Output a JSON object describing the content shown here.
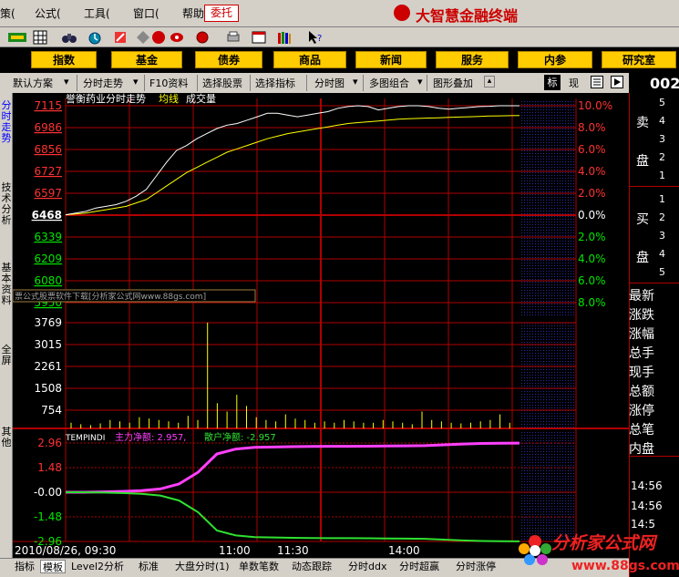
{
  "menubar": {
    "items": [
      "策(",
      "公式(",
      "工具(",
      "窗口(",
      "帮助("
    ],
    "weituo": "委托",
    "brand": "大智慧金融终端"
  },
  "nav": {
    "buttons": [
      "指数",
      "基金",
      "债券",
      "商品",
      "新闻",
      "服务",
      "内参",
      "研究室"
    ]
  },
  "ctrlbar": {
    "items": [
      "默认方案",
      "分时走势",
      "F10资料",
      "选择股票",
      "选择指标",
      "分时图",
      "多图组合",
      "图形叠加"
    ],
    "biao": "标",
    "xian": "现"
  },
  "leftstrip": {
    "tabs": [
      "分时走势",
      "技术分析",
      "基本资料",
      "全屏",
      "其他"
    ]
  },
  "chart": {
    "title": "誉衡药业分时走势",
    "avg_label": "均线",
    "vol_label": "成交量",
    "watermark": "票公式股票软件下载[分析家公式网www.88gs.com]",
    "indicator_name": "TEMPINDI",
    "main_label": "主力净额: 2.957,",
    "retail_label": "散户净额: -2.957",
    "date_label": "2010/08/26, 09:30",
    "time_ticks": [
      "11:00",
      "11:30",
      "14:00"
    ]
  },
  "chart_data": {
    "type": "line",
    "price_axis": {
      "ticks": [
        "7115",
        "6986",
        "6856",
        "6727",
        "6597",
        "6468",
        "6339",
        "6209",
        "6080",
        "5950"
      ],
      "pct_ticks": [
        "10.0%",
        "8.0%",
        "6.0%",
        "4.0%",
        "2.0%",
        "0.0%",
        "2.0%",
        "4.0%",
        "6.0%",
        "8.0%"
      ],
      "prev_close": 6468
    },
    "volume_axis": {
      "ticks": [
        "3769",
        "3015",
        "2261",
        "1508",
        "754"
      ]
    },
    "indicator_axis": {
      "ticks": [
        "2.96",
        "1.48",
        "-0.00",
        "-1.48",
        "-2.96"
      ]
    },
    "series": [
      {
        "name": "",
        "values": [
          6470,
          6480,
          6490,
          6510,
          6520,
          6530,
          6550,
          6580,
          6620,
          6700,
          6780,
          6850,
          6880,
          6920,
          6950,
          6980,
          7000,
          7010,
          7030,
          7050,
          7070,
          7070,
          7060,
          7050,
          7060,
          7070,
          7080,
          7100,
          7110,
          7115,
          7110,
          7090,
          7100,
          7110,
          7115,
          7115,
          7110,
          7100,
          7095,
          7100,
          7105,
          7110,
          7112,
          7115,
          7115,
          7115
        ]
      },
      {
        "name": "均线",
        "values": [
          6470,
          6475,
          6480,
          6490,
          6500,
          6510,
          6520,
          6540,
          6560,
          6600,
          6640,
          6680,
          6720,
          6750,
          6780,
          6810,
          6840,
          6860,
          6880,
          6900,
          6920,
          6935,
          6950,
          6960,
          6970,
          6980,
          6990,
          7000,
          7010,
          7015,
          7020,
          7025,
          7030,
          7035,
          7038,
          7040,
          7042,
          7044,
          7046,
          7048,
          7050,
          7052,
          7054,
          7055,
          7056,
          7057
        ]
      }
    ],
    "indicator_series": [
      {
        "name": "主力净额",
        "values": [
          0,
          0,
          0.02,
          0.05,
          0.1,
          0.2,
          0.5,
          1.2,
          2.3,
          2.6,
          2.7,
          2.72,
          2.74,
          2.75,
          2.76,
          2.76,
          2.77,
          2.78,
          2.79,
          2.8,
          2.85,
          2.9,
          2.93,
          2.95,
          2.957
        ]
      },
      {
        "name": "散户净额",
        "values": [
          0,
          0,
          -0.02,
          -0.05,
          -0.1,
          -0.2,
          -0.5,
          -1.2,
          -2.3,
          -2.6,
          -2.7,
          -2.72,
          -2.74,
          -2.75,
          -2.76,
          -2.76,
          -2.77,
          -2.78,
          -2.79,
          -2.8,
          -2.85,
          -2.9,
          -2.93,
          -2.95,
          -2.957
        ]
      }
    ],
    "volume": [
      200,
      150,
      120,
      180,
      300,
      250,
      200,
      400,
      350,
      300,
      250,
      200,
      450,
      300,
      3769,
      900,
      600,
      1200,
      800,
      400,
      300,
      250,
      500,
      350,
      300,
      200,
      250,
      200,
      300,
      250,
      200,
      200,
      300,
      250,
      200,
      150,
      600,
      300,
      250,
      200,
      180,
      200,
      250,
      300,
      500,
      200
    ]
  },
  "rightpanel": {
    "code": "002",
    "sell": [
      "卖",
      "盘"
    ],
    "buy": [
      "买",
      "盘"
    ],
    "sell_levels": [
      "5",
      "4",
      "3",
      "2",
      "1"
    ],
    "buy_levels": [
      "1",
      "2",
      "3",
      "4",
      "5"
    ],
    "labels": [
      "最新",
      "涨跌",
      "涨幅",
      "总手",
      "现手",
      "总额",
      "涨停",
      "总笔",
      "内盘"
    ],
    "time1": "14:56",
    "time2": "14:56",
    "time3": "14:5"
  },
  "bottombar": {
    "tabs": [
      "指标",
      "模板",
      "Level2分析",
      "标准",
      "大盘分时(1)",
      "单数笔数",
      "动态跟踪",
      "分时ddx",
      "分时超赢",
      "分时涨停"
    ]
  },
  "logo": {
    "text": "分析家公式网",
    "url": "www.88gs.com"
  },
  "colors": {
    "up": "#ff3232",
    "down": "#00e600",
    "price": "#ffffff",
    "avg": "#ffff00",
    "main": "#ff40ff",
    "retail": "#30e030",
    "grid": "#b00000"
  }
}
